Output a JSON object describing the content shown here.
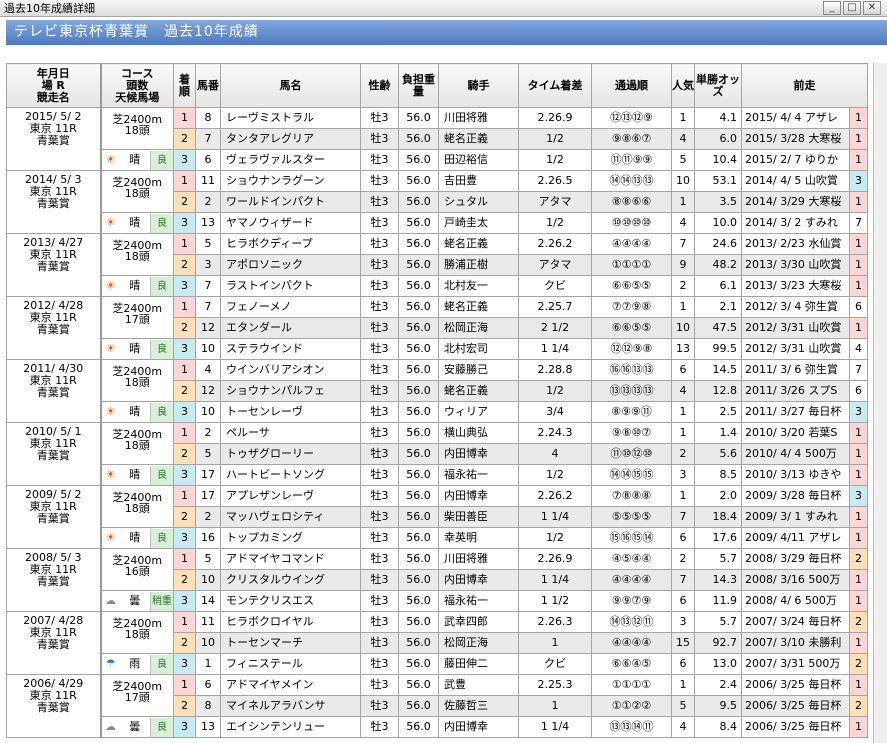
{
  "window": {
    "title": "過去10年成績詳細",
    "buttons": {
      "minimize": "_",
      "maximize": "□",
      "close": "✕"
    }
  },
  "header": {
    "title": "テレビ東京杯青葉賞　過去10年成績"
  },
  "columns": {
    "race": "年月日\n場 R\n競走名",
    "course": "コース\n頭数\n天候馬場",
    "finish": "着順",
    "post": "馬番",
    "horse": "馬名",
    "sexage": "性齢",
    "weight": "負担重量",
    "jockey": "騎手",
    "time": "タイム着差",
    "passing": "通過順",
    "pop": "人気",
    "odds": "単勝オッズ",
    "prev": "前走"
  },
  "races": [
    {
      "date": "2015/ 5/ 2",
      "place": "東京 11R",
      "name": "青葉賞",
      "course": "芝2400m",
      "heads": "18頭",
      "weather": "晴",
      "weather_icon": "sun",
      "ground": "良",
      "rows": [
        {
          "fin": "1",
          "post": "8",
          "horse": "レーヴミストラル",
          "sexage": "牡3",
          "wt": "56.0",
          "jockey": "川田将雅",
          "time": "2.26.9",
          "pass": "⑫⑬⑫⑨",
          "pop": "1",
          "odds": "4.1",
          "prev": "2015/ 4/ 4 アザレ",
          "prev_fin": "1"
        },
        {
          "fin": "2",
          "post": "7",
          "horse": "タンタアレグリア",
          "sexage": "牡3",
          "wt": "56.0",
          "jockey": "蛯名正義",
          "time": "1/2",
          "pass": "⑨⑧⑥⑦",
          "pop": "4",
          "odds": "6.0",
          "prev": "2015/ 3/28 大寒桜",
          "prev_fin": "1"
        },
        {
          "fin": "3",
          "post": "6",
          "horse": "ヴェラヴァルスター",
          "sexage": "牡3",
          "wt": "56.0",
          "jockey": "田辺裕信",
          "time": "1/2",
          "pass": "⑪⑪⑨⑨",
          "pop": "5",
          "odds": "10.4",
          "prev": "2015/ 2/ 7 ゆりか",
          "prev_fin": "1"
        }
      ]
    },
    {
      "date": "2014/ 5/ 3",
      "place": "東京 11R",
      "name": "青葉賞",
      "course": "芝2400m",
      "heads": "18頭",
      "weather": "晴",
      "weather_icon": "sun",
      "ground": "良",
      "rows": [
        {
          "fin": "1",
          "post": "11",
          "horse": "ショウナンラグーン",
          "sexage": "牡3",
          "wt": "56.0",
          "jockey": "吉田豊",
          "time": "2.26.5",
          "pass": "⑭⑭⑬⑬",
          "pop": "10",
          "odds": "53.1",
          "prev": "2014/ 4/ 5 山吹賞",
          "prev_fin": "3"
        },
        {
          "fin": "2",
          "post": "2",
          "horse": "ワールドインパクト",
          "sexage": "牡3",
          "wt": "56.0",
          "jockey": "シュタル",
          "time": "アタマ",
          "pass": "⑧⑧⑥⑥",
          "pop": "1",
          "odds": "3.5",
          "prev": "2014/ 3/29 大寒桜",
          "prev_fin": "1"
        },
        {
          "fin": "3",
          "post": "13",
          "horse": "ヤマノウィザード",
          "sexage": "牡3",
          "wt": "56.0",
          "jockey": "戸崎圭太",
          "time": "1/2",
          "pass": "⑩⑩⑩⑩",
          "pop": "4",
          "odds": "10.0",
          "prev": "2014/ 3/ 2 すみれ",
          "prev_fin": "7"
        }
      ]
    },
    {
      "date": "2013/ 4/27",
      "place": "東京 11R",
      "name": "青葉賞",
      "course": "芝2400m",
      "heads": "18頭",
      "weather": "晴",
      "weather_icon": "sun",
      "ground": "良",
      "rows": [
        {
          "fin": "1",
          "post": "5",
          "horse": "ヒラボクディープ",
          "sexage": "牡3",
          "wt": "56.0",
          "jockey": "蛯名正義",
          "time": "2.26.2",
          "pass": "④④④④",
          "pop": "7",
          "odds": "24.6",
          "prev": "2013/ 2/23 水仙賞",
          "prev_fin": "1"
        },
        {
          "fin": "2",
          "post": "3",
          "horse": "アポロソニック",
          "sexage": "牡3",
          "wt": "56.0",
          "jockey": "勝浦正樹",
          "time": "アタマ",
          "pass": "①①①①",
          "pop": "9",
          "odds": "48.2",
          "prev": "2013/ 3/30 山吹賞",
          "prev_fin": "1"
        },
        {
          "fin": "3",
          "post": "7",
          "horse": "ラストインパクト",
          "sexage": "牡3",
          "wt": "56.0",
          "jockey": "北村友一",
          "time": "クビ",
          "pass": "⑥⑥⑤⑤",
          "pop": "2",
          "odds": "6.1",
          "prev": "2013/ 3/23 大寒桜",
          "prev_fin": "1"
        }
      ]
    },
    {
      "date": "2012/ 4/28",
      "place": "東京 11R",
      "name": "青葉賞",
      "course": "芝2400m",
      "heads": "17頭",
      "weather": "晴",
      "weather_icon": "sun",
      "ground": "良",
      "rows": [
        {
          "fin": "1",
          "post": "7",
          "horse": "フェノーメノ",
          "sexage": "牡3",
          "wt": "56.0",
          "jockey": "蛯名正義",
          "time": "2.25.7",
          "pass": "⑦⑦⑨⑧",
          "pop": "1",
          "odds": "2.1",
          "prev": "2012/ 3/ 4 弥生賞",
          "prev_fin": "6"
        },
        {
          "fin": "2",
          "post": "12",
          "horse": "エタンダール",
          "sexage": "牡3",
          "wt": "56.0",
          "jockey": "松岡正海",
          "time": "2 1/2",
          "pass": "⑥⑥⑤⑤",
          "pop": "10",
          "odds": "47.5",
          "prev": "2012/ 3/31 山吹賞",
          "prev_fin": "1"
        },
        {
          "fin": "3",
          "post": "10",
          "horse": "ステラウインド",
          "sexage": "牡3",
          "wt": "56.0",
          "jockey": "北村宏司",
          "time": "1 1/4",
          "pass": "⑫⑫⑨⑧",
          "pop": "13",
          "odds": "99.5",
          "prev": "2012/ 3/31 山吹賞",
          "prev_fin": "4"
        }
      ]
    },
    {
      "date": "2011/ 4/30",
      "place": "東京 11R",
      "name": "青葉賞",
      "course": "芝2400m",
      "heads": "18頭",
      "weather": "晴",
      "weather_icon": "sun",
      "ground": "良",
      "rows": [
        {
          "fin": "1",
          "post": "4",
          "horse": "ウインバリアシオン",
          "sexage": "牡3",
          "wt": "56.0",
          "jockey": "安藤勝己",
          "time": "2.28.8",
          "pass": "⑯⑯⑬⑬",
          "pop": "6",
          "odds": "14.5",
          "prev": "2011/ 3/ 6 弥生賞",
          "prev_fin": "7"
        },
        {
          "fin": "2",
          "post": "12",
          "horse": "ショウナンパルフェ",
          "sexage": "牡3",
          "wt": "56.0",
          "jockey": "蛯名正義",
          "time": "1/2",
          "pass": "⑬⑬⑬⑬",
          "pop": "4",
          "odds": "12.8",
          "prev": "2011/ 3/26 スプS",
          "prev_fin": "6"
        },
        {
          "fin": "3",
          "post": "10",
          "horse": "トーセンレーヴ",
          "sexage": "牡3",
          "wt": "56.0",
          "jockey": "ウィリア",
          "time": "3/4",
          "pass": "⑧⑨⑨⑪",
          "pop": "1",
          "odds": "2.5",
          "prev": "2011/ 3/27 毎日杯",
          "prev_fin": "3"
        }
      ]
    },
    {
      "date": "2010/ 5/ 1",
      "place": "東京 11R",
      "name": "青葉賞",
      "course": "芝2400m",
      "heads": "18頭",
      "weather": "晴",
      "weather_icon": "sun",
      "ground": "良",
      "rows": [
        {
          "fin": "1",
          "post": "2",
          "horse": "ペルーサ",
          "sexage": "牡3",
          "wt": "56.0",
          "jockey": "横山典弘",
          "time": "2.24.3",
          "pass": "⑨⑧⑩⑦",
          "pop": "1",
          "odds": "1.4",
          "prev": "2010/ 3/20 若葉S",
          "prev_fin": "1"
        },
        {
          "fin": "2",
          "post": "5",
          "horse": "トゥザグローリー",
          "sexage": "牡3",
          "wt": "56.0",
          "jockey": "内田博幸",
          "time": "4",
          "pass": "⑪⑩⑫⑩",
          "pop": "2",
          "odds": "5.6",
          "prev": "2010/ 4/ 4 500万",
          "prev_fin": "1"
        },
        {
          "fin": "3",
          "post": "17",
          "horse": "ハートビートソング",
          "sexage": "牡3",
          "wt": "56.0",
          "jockey": "福永祐一",
          "time": "1/2",
          "pass": "⑭⑭⑮⑮",
          "pop": "3",
          "odds": "8.5",
          "prev": "2010/ 3/13 ゆきや",
          "prev_fin": "1"
        }
      ]
    },
    {
      "date": "2009/ 5/ 2",
      "place": "東京 11R",
      "name": "青葉賞",
      "course": "芝2400m",
      "heads": "18頭",
      "weather": "晴",
      "weather_icon": "sun",
      "ground": "良",
      "rows": [
        {
          "fin": "1",
          "post": "17",
          "horse": "アプレザンレーヴ",
          "sexage": "牡3",
          "wt": "56.0",
          "jockey": "内田博幸",
          "time": "2.26.2",
          "pass": "⑦⑧⑧⑧",
          "pop": "1",
          "odds": "2.0",
          "prev": "2009/ 3/28 毎日杯",
          "prev_fin": "3"
        },
        {
          "fin": "2",
          "post": "2",
          "horse": "マッハヴェロシティ",
          "sexage": "牡3",
          "wt": "56.0",
          "jockey": "柴田善臣",
          "time": "1 1/4",
          "pass": "⑤⑤⑤⑤",
          "pop": "7",
          "odds": "18.4",
          "prev": "2009/ 3/ 1 すみれ",
          "prev_fin": "1"
        },
        {
          "fin": "3",
          "post": "16",
          "horse": "トップカミング",
          "sexage": "牡3",
          "wt": "56.0",
          "jockey": "幸英明",
          "time": "1/2",
          "pass": "⑮⑯⑮⑭",
          "pop": "6",
          "odds": "17.6",
          "prev": "2009/ 4/11 アザレ",
          "prev_fin": "1"
        }
      ]
    },
    {
      "date": "2008/ 5/ 3",
      "place": "東京 11R",
      "name": "青葉賞",
      "course": "芝2400m",
      "heads": "16頭",
      "weather": "曇",
      "weather_icon": "cloud",
      "ground": "稍重",
      "rows": [
        {
          "fin": "1",
          "post": "5",
          "horse": "アドマイヤコマンド",
          "sexage": "牡3",
          "wt": "56.0",
          "jockey": "川田将雅",
          "time": "2.26.9",
          "pass": "④⑤④④",
          "pop": "2",
          "odds": "5.7",
          "prev": "2008/ 3/29 毎日杯",
          "prev_fin": "2"
        },
        {
          "fin": "2",
          "post": "10",
          "horse": "クリスタルウイング",
          "sexage": "牡3",
          "wt": "56.0",
          "jockey": "内田博幸",
          "time": "1 1/4",
          "pass": "④④④④",
          "pop": "7",
          "odds": "14.3",
          "prev": "2008/ 3/16 500万",
          "prev_fin": "1"
        },
        {
          "fin": "3",
          "post": "14",
          "horse": "モンテクリスエス",
          "sexage": "牡3",
          "wt": "56.0",
          "jockey": "福永祐一",
          "time": "1 1/2",
          "pass": "⑨⑨⑦⑨",
          "pop": "6",
          "odds": "11.9",
          "prev": "2008/ 4/ 6 500万",
          "prev_fin": "1"
        }
      ]
    },
    {
      "date": "2007/ 4/28",
      "place": "東京 11R",
      "name": "青葉賞",
      "course": "芝2400m",
      "heads": "18頭",
      "weather": "雨",
      "weather_icon": "umbrella",
      "ground": "良",
      "rows": [
        {
          "fin": "1",
          "post": "11",
          "horse": "ヒラボクロイヤル",
          "sexage": "牡3",
          "wt": "56.0",
          "jockey": "武幸四郎",
          "time": "2.26.3",
          "pass": "⑭⑬⑫⑪",
          "pop": "3",
          "odds": "5.7",
          "prev": "2007/ 3/24 毎日杯",
          "prev_fin": "2"
        },
        {
          "fin": "2",
          "post": "10",
          "horse": "トーセンマーチ",
          "sexage": "牡3",
          "wt": "56.0",
          "jockey": "松岡正海",
          "time": "1",
          "pass": "④④④④",
          "pop": "15",
          "odds": "92.7",
          "prev": "2007/ 3/10 未勝利",
          "prev_fin": "1"
        },
        {
          "fin": "3",
          "post": "1",
          "horse": "フィニステール",
          "sexage": "牡3",
          "wt": "56.0",
          "jockey": "藤田伸二",
          "time": "クビ",
          "pass": "⑥⑥④⑤",
          "pop": "6",
          "odds": "13.0",
          "prev": "2007/ 3/31 500万",
          "prev_fin": "2"
        }
      ]
    },
    {
      "date": "2006/ 4/29",
      "place": "東京 11R",
      "name": "青葉賞",
      "course": "芝2400m",
      "heads": "17頭",
      "weather": "曇",
      "weather_icon": "cloud",
      "ground": "良",
      "rows": [
        {
          "fin": "1",
          "post": "6",
          "horse": "アドマイヤメイン",
          "sexage": "牡3",
          "wt": "56.0",
          "jockey": "武豊",
          "time": "2.25.3",
          "pass": "①①①①",
          "pop": "1",
          "odds": "2.4",
          "prev": "2006/ 3/25 毎日杯",
          "prev_fin": "1"
        },
        {
          "fin": "2",
          "post": "8",
          "horse": "マイネルアラバンサ",
          "sexage": "牡3",
          "wt": "56.0",
          "jockey": "佐藤哲三",
          "time": "1",
          "pass": "①①②②",
          "pop": "5",
          "odds": "9.5",
          "prev": "2006/ 3/25 毎日杯",
          "prev_fin": "2"
        },
        {
          "fin": "3",
          "post": "13",
          "horse": "エイシンテンリュー",
          "sexage": "牡3",
          "wt": "56.0",
          "jockey": "内田博幸",
          "time": "1 1/4",
          "pass": "⑬⑬⑭⑪",
          "pop": "4",
          "odds": "8.4",
          "prev": "2006/ 3/25 毎日杯",
          "prev_fin": "1"
        }
      ]
    }
  ]
}
